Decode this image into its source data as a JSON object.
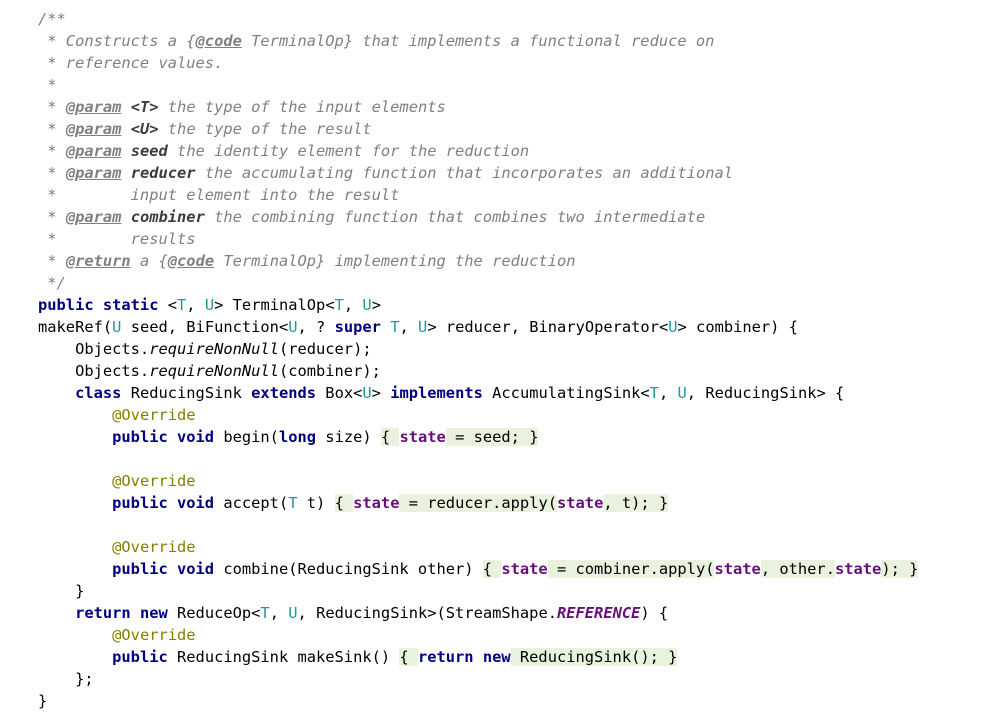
{
  "editor": {
    "lines": [
      [
        {
          "t": "/**",
          "s": "doc"
        }
      ],
      [
        {
          "t": " * Constructs a {",
          "s": "doc"
        },
        {
          "t": "@code",
          "s": "tag"
        },
        {
          "t": " TerminalOp} that implements a functional reduce on",
          "s": "doc"
        }
      ],
      [
        {
          "t": " * reference values.",
          "s": "doc"
        }
      ],
      [
        {
          "t": " *",
          "s": "doc"
        }
      ],
      [
        {
          "t": " * ",
          "s": "doc"
        },
        {
          "t": "@param",
          "s": "tag"
        },
        {
          "t": " ",
          "s": "doc"
        },
        {
          "t": "<T>",
          "s": "docbold"
        },
        {
          "t": " the type of the input elements",
          "s": "doc"
        }
      ],
      [
        {
          "t": " * ",
          "s": "doc"
        },
        {
          "t": "@param",
          "s": "tag"
        },
        {
          "t": " ",
          "s": "doc"
        },
        {
          "t": "<U>",
          "s": "docbold"
        },
        {
          "t": " the type of the result",
          "s": "doc"
        }
      ],
      [
        {
          "t": " * ",
          "s": "doc"
        },
        {
          "t": "@param",
          "s": "tag"
        },
        {
          "t": " ",
          "s": "doc"
        },
        {
          "t": "seed",
          "s": "docbold"
        },
        {
          "t": " the identity element for the reduction",
          "s": "doc"
        }
      ],
      [
        {
          "t": " * ",
          "s": "doc"
        },
        {
          "t": "@param",
          "s": "tag"
        },
        {
          "t": " ",
          "s": "doc"
        },
        {
          "t": "reducer",
          "s": "docbold"
        },
        {
          "t": " the accumulating function that incorporates an additional",
          "s": "doc"
        }
      ],
      [
        {
          "t": " *        input element into the result",
          "s": "doc"
        }
      ],
      [
        {
          "t": " * ",
          "s": "doc"
        },
        {
          "t": "@param",
          "s": "tag"
        },
        {
          "t": " ",
          "s": "doc"
        },
        {
          "t": "combiner",
          "s": "docbold"
        },
        {
          "t": " the combining function that combines two intermediate",
          "s": "doc"
        }
      ],
      [
        {
          "t": " *        results",
          "s": "doc"
        }
      ],
      [
        {
          "t": " * ",
          "s": "doc"
        },
        {
          "t": "@return",
          "s": "tag"
        },
        {
          "t": " a {",
          "s": "doc"
        },
        {
          "t": "@code",
          "s": "tag"
        },
        {
          "t": " TerminalOp} implementing the reduction",
          "s": "doc"
        }
      ],
      [
        {
          "t": " */",
          "s": "doc"
        }
      ],
      [
        {
          "t": "public static",
          "s": "kw"
        },
        {
          "t": " <",
          "s": "plain"
        },
        {
          "t": "T",
          "s": "tp"
        },
        {
          "t": ", ",
          "s": "plain"
        },
        {
          "t": "U",
          "s": "tp"
        },
        {
          "t": "> TerminalOp<",
          "s": "plain"
        },
        {
          "t": "T",
          "s": "tp"
        },
        {
          "t": ", ",
          "s": "plain"
        },
        {
          "t": "U",
          "s": "tp"
        },
        {
          "t": ">",
          "s": "plain"
        }
      ],
      [
        {
          "t": "makeRef(",
          "s": "plain"
        },
        {
          "t": "U",
          "s": "tp"
        },
        {
          "t": " seed, BiFunction<",
          "s": "plain"
        },
        {
          "t": "U",
          "s": "tp"
        },
        {
          "t": ", ? ",
          "s": "plain"
        },
        {
          "t": "super",
          "s": "kw"
        },
        {
          "t": " ",
          "s": "plain"
        },
        {
          "t": "T",
          "s": "tp"
        },
        {
          "t": ", ",
          "s": "plain"
        },
        {
          "t": "U",
          "s": "tp"
        },
        {
          "t": "> reducer, BinaryOperator<",
          "s": "plain"
        },
        {
          "t": "U",
          "s": "tp"
        },
        {
          "t": "> combiner) {",
          "s": "plain"
        }
      ],
      [
        {
          "t": "    Objects.",
          "s": "plain"
        },
        {
          "t": "requireNonNull",
          "s": "static"
        },
        {
          "t": "(reducer);",
          "s": "plain"
        }
      ],
      [
        {
          "t": "    Objects.",
          "s": "plain"
        },
        {
          "t": "requireNonNull",
          "s": "static"
        },
        {
          "t": "(combiner);",
          "s": "plain"
        }
      ],
      [
        {
          "t": "    ",
          "s": "plain"
        },
        {
          "t": "class",
          "s": "kw"
        },
        {
          "t": " ReducingSink ",
          "s": "plain"
        },
        {
          "t": "extends",
          "s": "kw"
        },
        {
          "t": " Box<",
          "s": "plain"
        },
        {
          "t": "U",
          "s": "tp"
        },
        {
          "t": "> ",
          "s": "plain"
        },
        {
          "t": "implements",
          "s": "kw"
        },
        {
          "t": " AccumulatingSink<",
          "s": "plain"
        },
        {
          "t": "T",
          "s": "tp"
        },
        {
          "t": ", ",
          "s": "plain"
        },
        {
          "t": "U",
          "s": "tp"
        },
        {
          "t": ", ReducingSink> {",
          "s": "plain"
        }
      ],
      [
        {
          "t": "        ",
          "s": "plain"
        },
        {
          "t": "@Override",
          "s": "ann"
        }
      ],
      [
        {
          "t": "        ",
          "s": "plain"
        },
        {
          "t": "public void",
          "s": "kw"
        },
        {
          "t": " begin(",
          "s": "plain"
        },
        {
          "t": "long",
          "s": "kw"
        },
        {
          "t": " size) ",
          "s": "plain"
        },
        {
          "t": "{ ",
          "s": "brace"
        },
        {
          "t": "state",
          "s": "field"
        },
        {
          "t": " = seed; }",
          "s": "brace"
        }
      ],
      [
        {
          "t": "",
          "s": "plain"
        }
      ],
      [
        {
          "t": "        ",
          "s": "plain"
        },
        {
          "t": "@Override",
          "s": "ann"
        }
      ],
      [
        {
          "t": "        ",
          "s": "plain"
        },
        {
          "t": "public void",
          "s": "kw"
        },
        {
          "t": " accept(",
          "s": "plain"
        },
        {
          "t": "T",
          "s": "tp"
        },
        {
          "t": " t) ",
          "s": "plain"
        },
        {
          "t": "{ ",
          "s": "brace"
        },
        {
          "t": "state",
          "s": "field"
        },
        {
          "t": " = reducer.apply(",
          "s": "brace"
        },
        {
          "t": "state",
          "s": "field"
        },
        {
          "t": ", t); }",
          "s": "brace"
        }
      ],
      [
        {
          "t": "",
          "s": "plain"
        }
      ],
      [
        {
          "t": "        ",
          "s": "plain"
        },
        {
          "t": "@Override",
          "s": "ann"
        }
      ],
      [
        {
          "t": "        ",
          "s": "plain"
        },
        {
          "t": "public void",
          "s": "kw"
        },
        {
          "t": " combine(ReducingSink other) ",
          "s": "plain"
        },
        {
          "t": "{ ",
          "s": "brace"
        },
        {
          "t": "state",
          "s": "field"
        },
        {
          "t": " = combiner.apply(",
          "s": "brace"
        },
        {
          "t": "state",
          "s": "field"
        },
        {
          "t": ", other.",
          "s": "brace"
        },
        {
          "t": "state",
          "s": "field"
        },
        {
          "t": "); }",
          "s": "brace"
        }
      ],
      [
        {
          "t": "    }",
          "s": "plain"
        }
      ],
      [
        {
          "t": "    ",
          "s": "plain"
        },
        {
          "t": "return new",
          "s": "kw"
        },
        {
          "t": " ReduceOp<",
          "s": "plain"
        },
        {
          "t": "T",
          "s": "tp"
        },
        {
          "t": ", ",
          "s": "plain"
        },
        {
          "t": "U",
          "s": "tp"
        },
        {
          "t": ", ReducingSink>(StreamShape.",
          "s": "plain"
        },
        {
          "t": "REFERENCE",
          "s": "const"
        },
        {
          "t": ") {",
          "s": "plain"
        }
      ],
      [
        {
          "t": "        ",
          "s": "plain"
        },
        {
          "t": "@Override",
          "s": "ann"
        }
      ],
      [
        {
          "t": "        ",
          "s": "plain"
        },
        {
          "t": "public",
          "s": "kw"
        },
        {
          "t": " ReducingSink makeSink() ",
          "s": "plain"
        },
        {
          "t": "{ ",
          "s": "brace"
        },
        {
          "t": "return new",
          "s": "kw"
        },
        {
          "t": " ReducingSink(); }",
          "s": "brace"
        }
      ],
      [
        {
          "t": "    };",
          "s": "plain"
        }
      ],
      [
        {
          "t": "}",
          "s": "plain"
        }
      ]
    ]
  },
  "colors": {
    "comment": "#808080",
    "keyword": "#000080",
    "type_param": "#20999d",
    "field": "#660e7a",
    "annotation": "#808000",
    "brace_highlight": "#e8f2dd"
  }
}
